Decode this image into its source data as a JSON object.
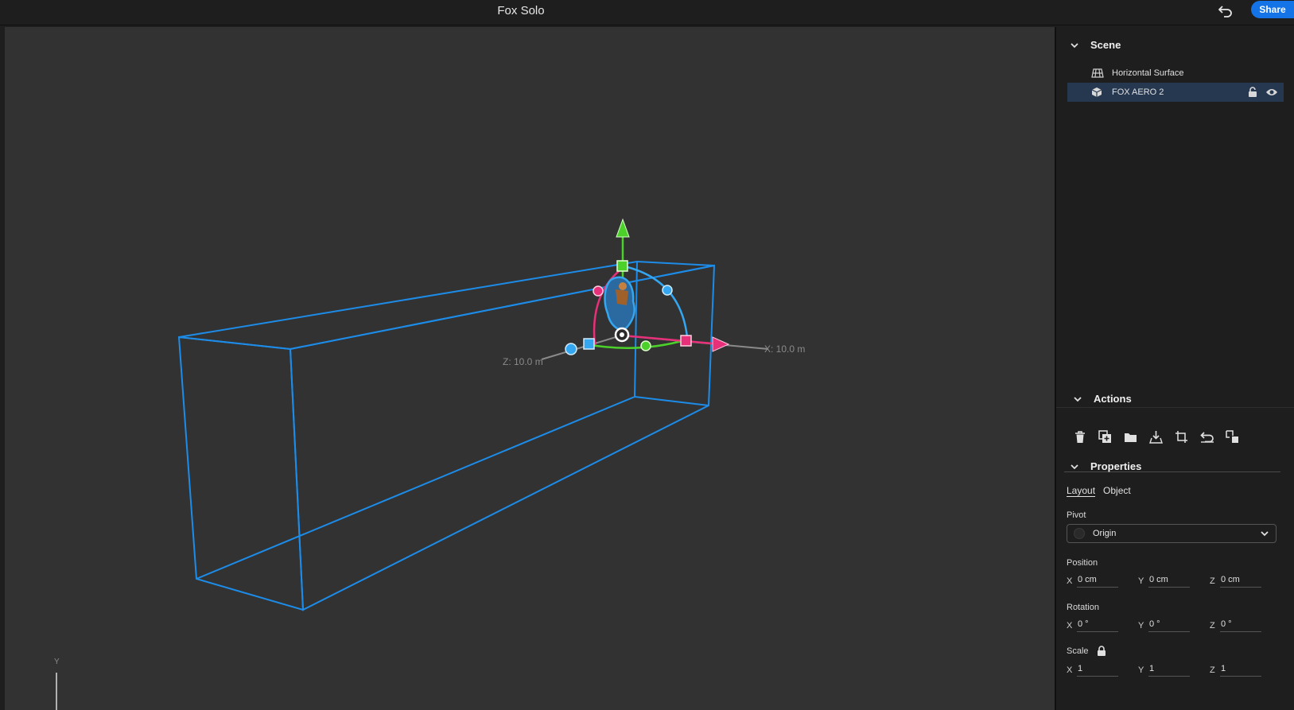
{
  "app": {
    "title": "Fox Solo",
    "share_label": "Share"
  },
  "viewport": {
    "z_axis_label": "Z: 10.0 m",
    "x_axis_label": "X: 10.0 m",
    "y_axis_label": "Y"
  },
  "scene": {
    "title": "Scene",
    "items": [
      {
        "label": "Horizontal Surface",
        "icon": "surface-icon"
      },
      {
        "label": "FOX AERO 2",
        "icon": "cube-icon",
        "selected": true
      }
    ]
  },
  "actions": {
    "title": "Actions",
    "items": [
      "delete-icon",
      "duplicate-icon",
      "folder-icon",
      "place-on-ground-icon",
      "crop-bounds-icon",
      "reset-icon",
      "replace-icon"
    ]
  },
  "properties": {
    "title": "Properties",
    "tabs": [
      {
        "label": "Layout",
        "active": true
      },
      {
        "label": "Object",
        "active": false
      }
    ],
    "pivot": {
      "label": "Pivot",
      "value": "Origin"
    },
    "position": {
      "label": "Position",
      "x_axis": "X",
      "y_axis": "Y",
      "z_axis": "Z",
      "x": "0 cm",
      "y": "0 cm",
      "z": "0 cm"
    },
    "rotation": {
      "label": "Rotation",
      "x_axis": "X",
      "y_axis": "Y",
      "z_axis": "Z",
      "x": "0 °",
      "y": "0 °",
      "z": "0 °"
    },
    "scale": {
      "label": "Scale",
      "x_axis": "X",
      "y_axis": "Y",
      "z_axis": "Z",
      "x": "1",
      "y": "1",
      "z": "1"
    }
  },
  "colors": {
    "accent": "#1473e6",
    "bbox": "#1d8ce8",
    "gizmo_green": "#4bd12a",
    "gizmo_pink": "#e8307a",
    "gizmo_blue": "#35a6f0"
  }
}
